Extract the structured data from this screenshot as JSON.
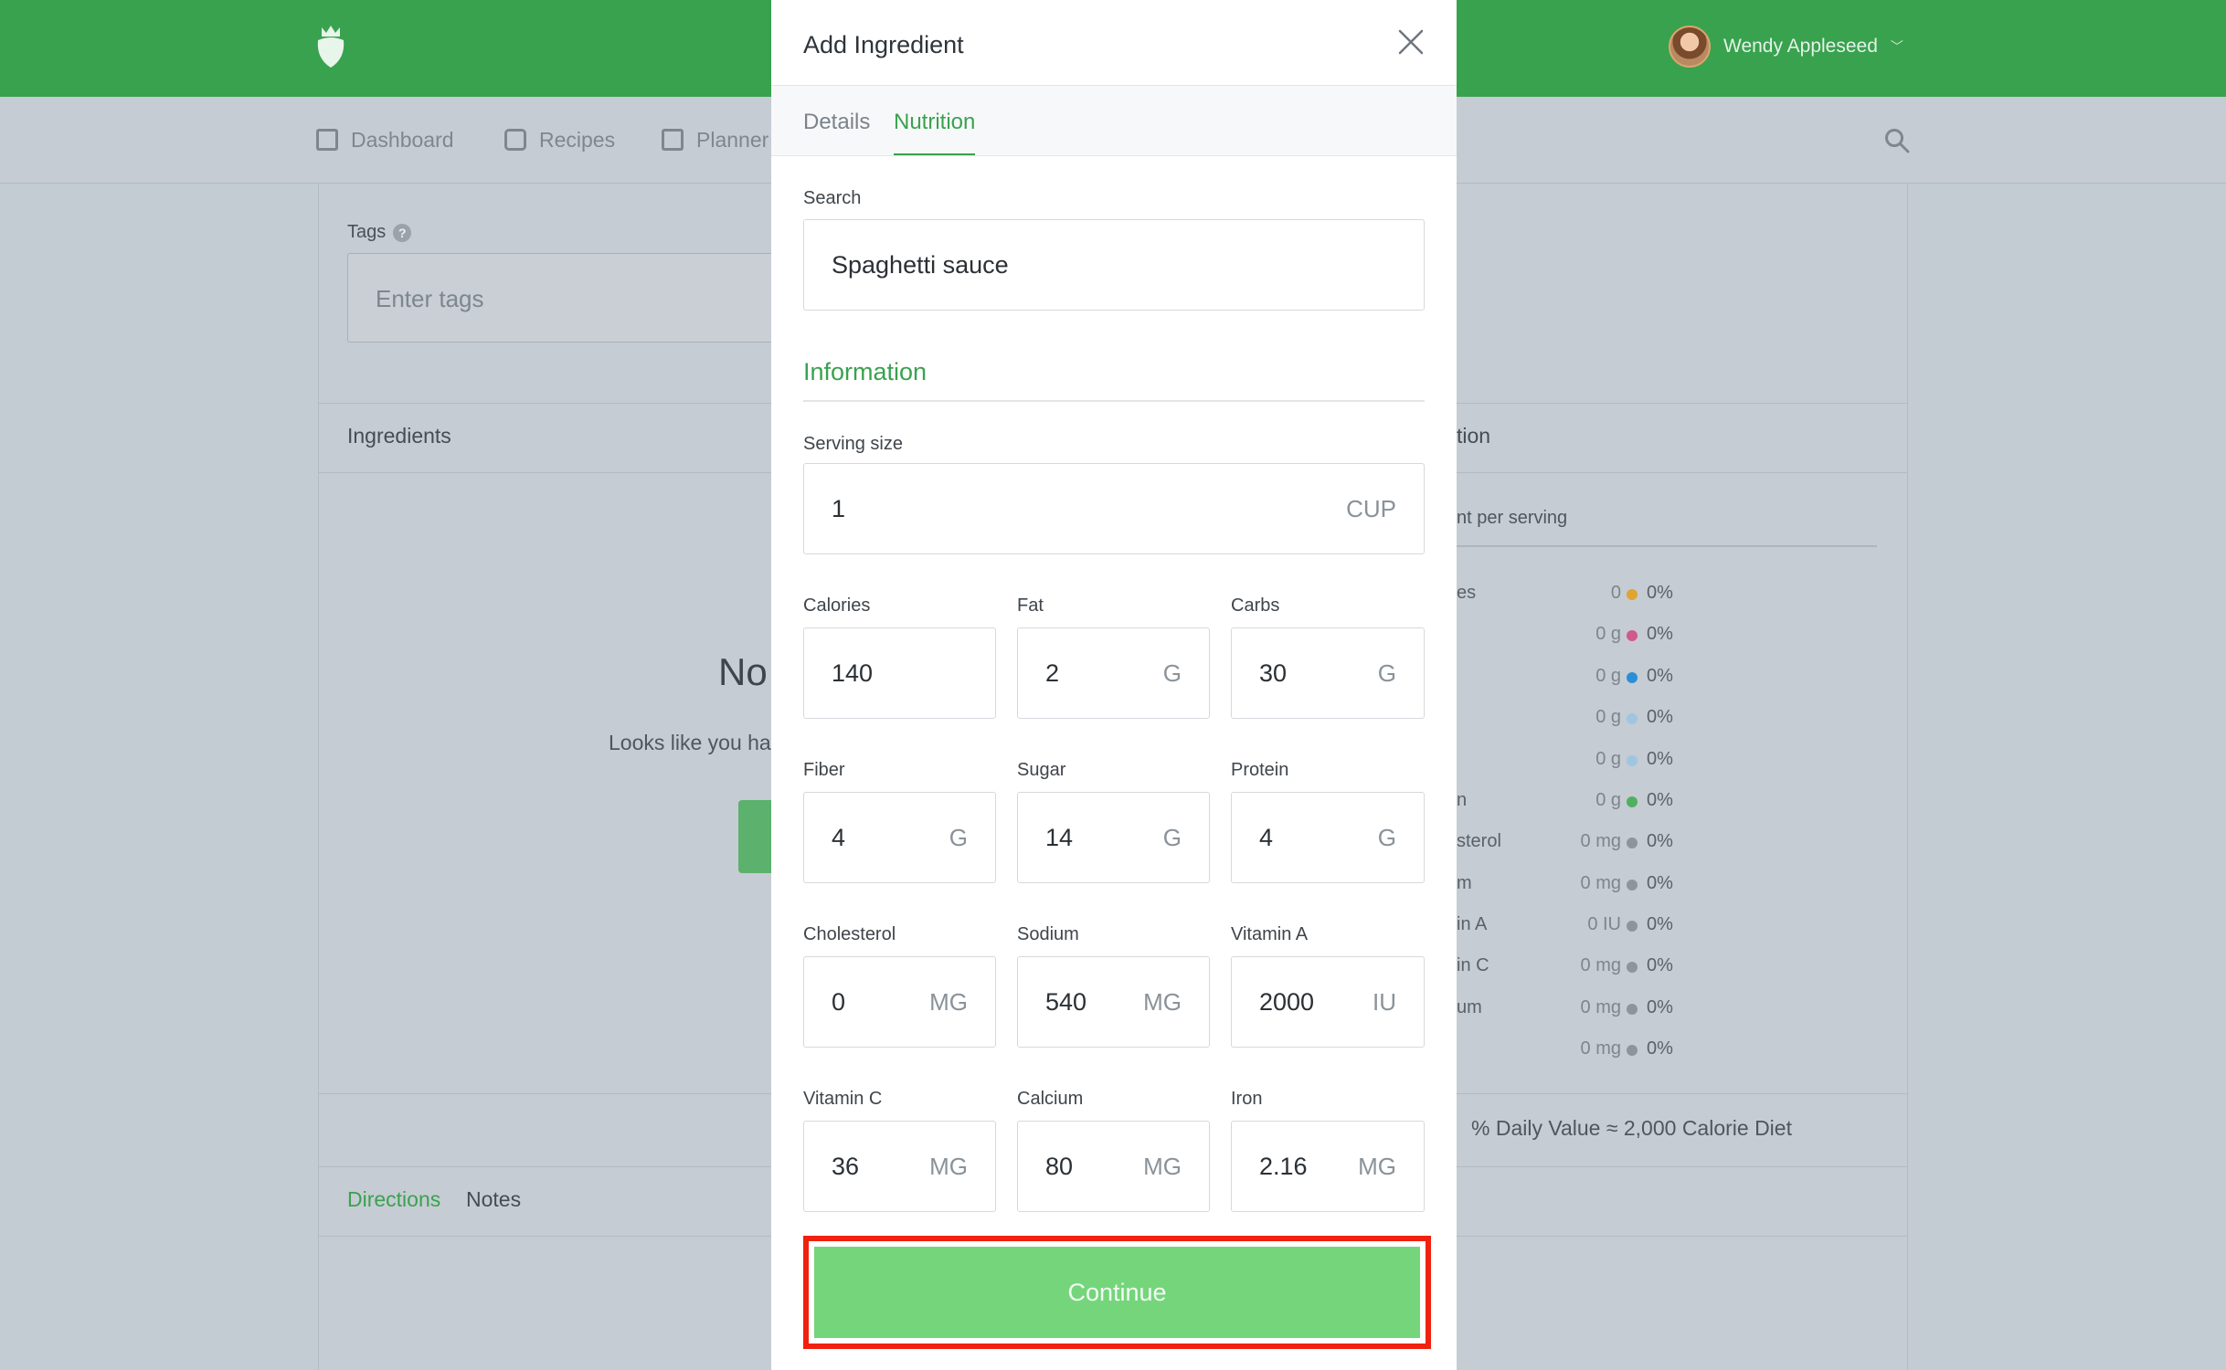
{
  "header": {
    "user_name": "Wendy Appleseed"
  },
  "nav": {
    "items": [
      {
        "label": "Dashboard",
        "icon": "dashboard-icon"
      },
      {
        "label": "Recipes",
        "icon": "inbox-icon"
      },
      {
        "label": "Planner",
        "icon": "calendar-icon"
      }
    ]
  },
  "background": {
    "tags_label": "Tags",
    "tags_placeholder": "Enter tags",
    "ingredients_heading": "Ingredients",
    "empty_title": "No",
    "empty_subtitle": "Looks like you ha",
    "directions_tab": "Directions",
    "notes_tab": "Notes",
    "nutrition_heading": "tion",
    "per_serving": "nt per serving",
    "nutrition_rows": [
      {
        "label": "es",
        "value": "0",
        "pct": "0%",
        "color": "#e0a531"
      },
      {
        "label": "",
        "value": "0 g",
        "pct": "0%",
        "color": "#d05a8a"
      },
      {
        "label": "",
        "value": "0 g",
        "pct": "0%",
        "color": "#2b8fd6"
      },
      {
        "label": "",
        "value": "0 g",
        "pct": "0%",
        "color": "#9ec6e0"
      },
      {
        "label": "",
        "value": "0 g",
        "pct": "0%",
        "color": "#9ec6e0"
      },
      {
        "label": "n",
        "value": "0 g",
        "pct": "0%",
        "color": "#4fb060"
      },
      {
        "label": "sterol",
        "value": "0 mg",
        "pct": "0%",
        "color": "#8d959c"
      },
      {
        "label": "m",
        "value": "0 mg",
        "pct": "0%",
        "color": "#8d959c"
      },
      {
        "label": "in A",
        "value": "0 IU",
        "pct": "0%",
        "color": "#8d959c"
      },
      {
        "label": "in C",
        "value": "0 mg",
        "pct": "0%",
        "color": "#8d959c"
      },
      {
        "label": "um",
        "value": "0 mg",
        "pct": "0%",
        "color": "#8d959c"
      },
      {
        "label": "",
        "value": "0 mg",
        "pct": "0%",
        "color": "#8d959c"
      }
    ],
    "daily_value_note": "% Daily Value ≈ 2,000 Calorie Diet"
  },
  "modal": {
    "title": "Add Ingredient",
    "tabs": [
      {
        "label": "Details",
        "active": false
      },
      {
        "label": "Nutrition",
        "active": true
      }
    ],
    "search_label": "Search",
    "search_value": "Spaghetti sauce",
    "information_heading": "Information",
    "serving_size_label": "Serving size",
    "serving_size_value": "1",
    "serving_size_unit": "CUP",
    "nutrients": [
      {
        "label": "Calories",
        "value": "140",
        "unit": ""
      },
      {
        "label": "Fat",
        "value": "2",
        "unit": "G"
      },
      {
        "label": "Carbs",
        "value": "30",
        "unit": "G"
      },
      {
        "label": "Fiber",
        "value": "4",
        "unit": "G"
      },
      {
        "label": "Sugar",
        "value": "14",
        "unit": "G"
      },
      {
        "label": "Protein",
        "value": "4",
        "unit": "G"
      },
      {
        "label": "Cholesterol",
        "value": "0",
        "unit": "MG"
      },
      {
        "label": "Sodium",
        "value": "540",
        "unit": "MG"
      },
      {
        "label": "Vitamin A",
        "value": "2000",
        "unit": "IU"
      },
      {
        "label": "Vitamin C",
        "value": "36",
        "unit": "MG"
      },
      {
        "label": "Calcium",
        "value": "80",
        "unit": "MG"
      },
      {
        "label": "Iron",
        "value": "2.16",
        "unit": "MG"
      }
    ],
    "continue_label": "Continue"
  },
  "colors": {
    "brand_green": "#39a24f",
    "button_green": "#75d57b",
    "highlight_red": "#f0210e"
  }
}
